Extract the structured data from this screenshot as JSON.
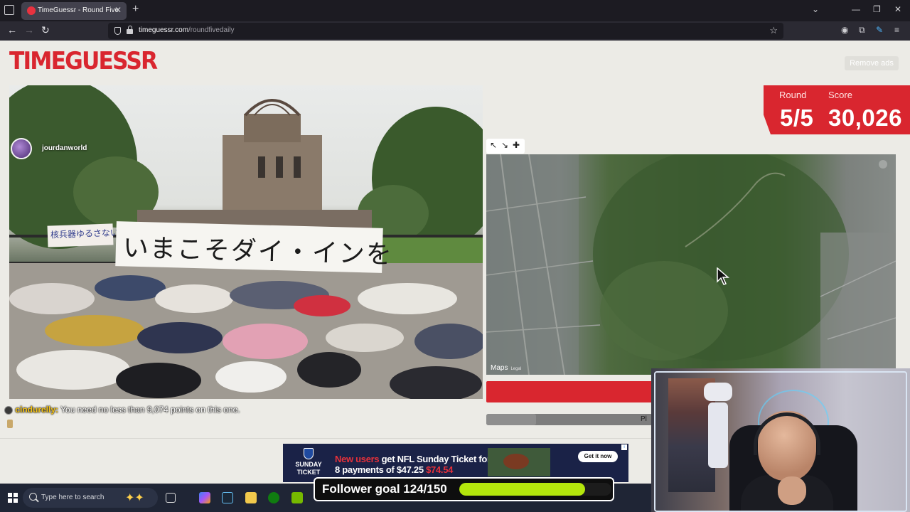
{
  "browser": {
    "tab_title": "TimeGuessr - Round Five",
    "url_host": "timeguessr.com",
    "url_path": "/roundfivedaily",
    "icons": [
      "tab-list-icon",
      "shield-icon",
      "lock-icon",
      "star-icon",
      "account-icon",
      "extensions-icon",
      "menu-icon"
    ]
  },
  "site": {
    "logo": "TIMEGUESSR",
    "remove_ads": "Remove ads",
    "accent_color": "#d9262f"
  },
  "status": {
    "round_label": "Round",
    "score_label": "Score",
    "round_value": "5/5",
    "score_value": "30,026"
  },
  "photo": {
    "username": "jourdanworld",
    "banner_text": "いまこそダイ・インを",
    "small_banner_text": "核兵器ゆるさない"
  },
  "map": {
    "attribution": "Maps",
    "legal": "Legal",
    "tool_icons": [
      "expand-icon",
      "shrink-icon",
      "pin-icon"
    ]
  },
  "guess": {
    "progress_text": "Pl",
    "progress_fraction": 0.3
  },
  "chat": {
    "username": "cindurelly",
    "message": "You need no less than 9,074 points on this one."
  },
  "ad": {
    "brand_line1": "SUNDAY",
    "brand_line2": "TICKET",
    "headline_red": "New users",
    "headline": " get NFL Sunday Ticket for",
    "line2": "8 payments of $47.25",
    "line2_red": " $74.54",
    "cta": "Get it now"
  },
  "follower_goal": {
    "label": "Follower goal 124/150",
    "current": 124,
    "target": 150,
    "bar_color": "#b4e60c"
  },
  "taskbar": {
    "search_placeholder": "Type here to search",
    "apps": [
      "copilot",
      "steam",
      "file-explorer",
      "xbox",
      "nvidia"
    ]
  }
}
